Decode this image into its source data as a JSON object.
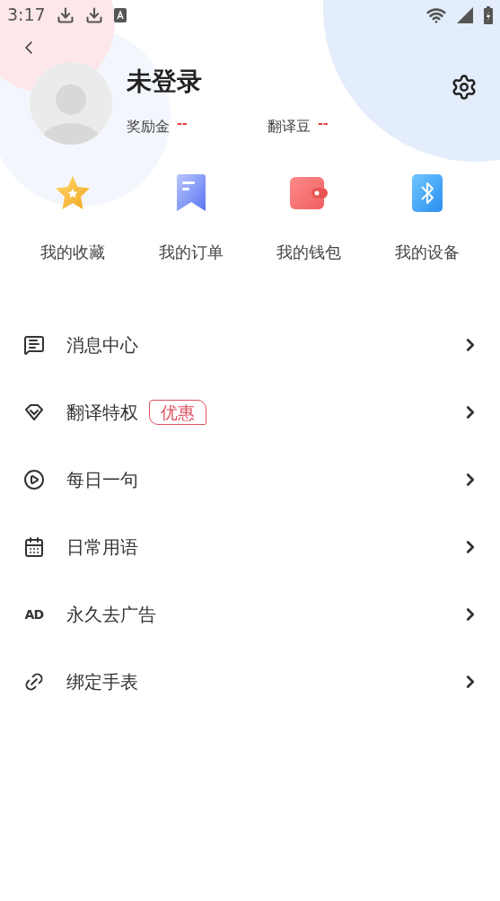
{
  "status_bar": {
    "time": "3:17"
  },
  "profile": {
    "name": "未登录",
    "stats": [
      {
        "label": "奖励金",
        "value": "--"
      },
      {
        "label": "翻译豆",
        "value": "--"
      }
    ]
  },
  "shortcuts": [
    {
      "kind": "star",
      "label": "我的收藏"
    },
    {
      "kind": "order",
      "label": "我的订单"
    },
    {
      "kind": "wallet",
      "label": "我的钱包"
    },
    {
      "kind": "device",
      "label": "我的设备"
    }
  ],
  "menu": [
    {
      "kind": "message",
      "label": "消息中心"
    },
    {
      "kind": "privilege",
      "label": "翻译特权",
      "badge": "优惠"
    },
    {
      "kind": "play",
      "label": "每日一句"
    },
    {
      "kind": "calendar",
      "label": "日常用语"
    },
    {
      "kind": "ad",
      "label": "永久去广告",
      "icon_text": "AD"
    },
    {
      "kind": "link",
      "label": "绑定手表"
    }
  ]
}
